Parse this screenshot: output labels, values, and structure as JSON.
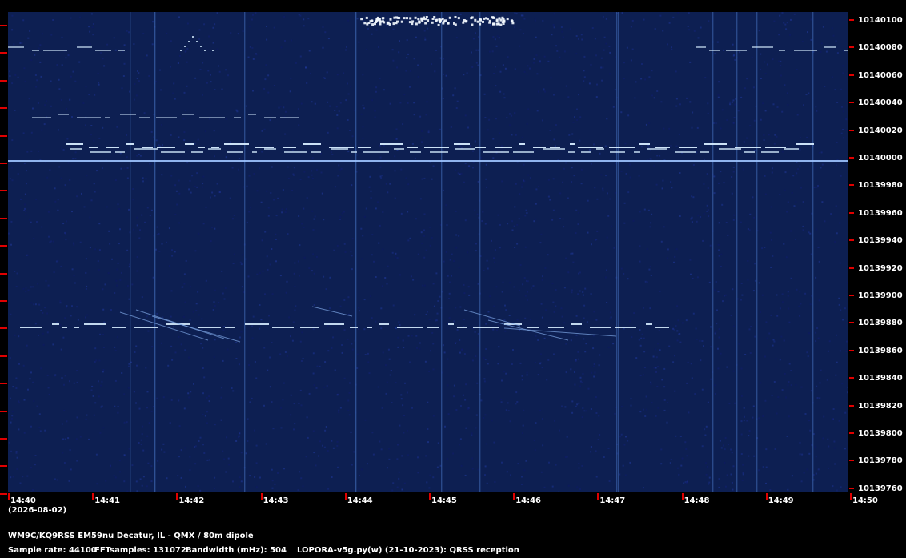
{
  "frequency_labels": [
    "10140100",
    "10140080",
    "10140060",
    "10140040",
    "10140020",
    "10140000",
    "10139980",
    "10139960",
    "10139940",
    "10139920",
    "10139900",
    "10139880",
    "10139860",
    "10139840",
    "10139820",
    "10139800",
    "10139780",
    "10139760"
  ],
  "time_labels": [
    "14:40",
    "14:41",
    "14:42",
    "14:43",
    "14:44",
    "14:45",
    "14:46",
    "14:47",
    "14:48",
    "14:49",
    "14:50"
  ],
  "date_label": "(2026-08-02)",
  "footer": {
    "station": "WM9C/KQ9RSS EM59nu Decatur, IL - QMX / 80m dipole",
    "sample_rate": "Sample rate: 44100",
    "fft_samples": "FFTsamples: 131072",
    "bandwidth": "Bandwidth (mHz): 504",
    "software": "LOPORA-v5g.py(w) (21-10-2023): QRSS reception"
  },
  "colors": {
    "background": "#0d1f52",
    "signal": "#d6ecff",
    "tick": "#e00000"
  }
}
